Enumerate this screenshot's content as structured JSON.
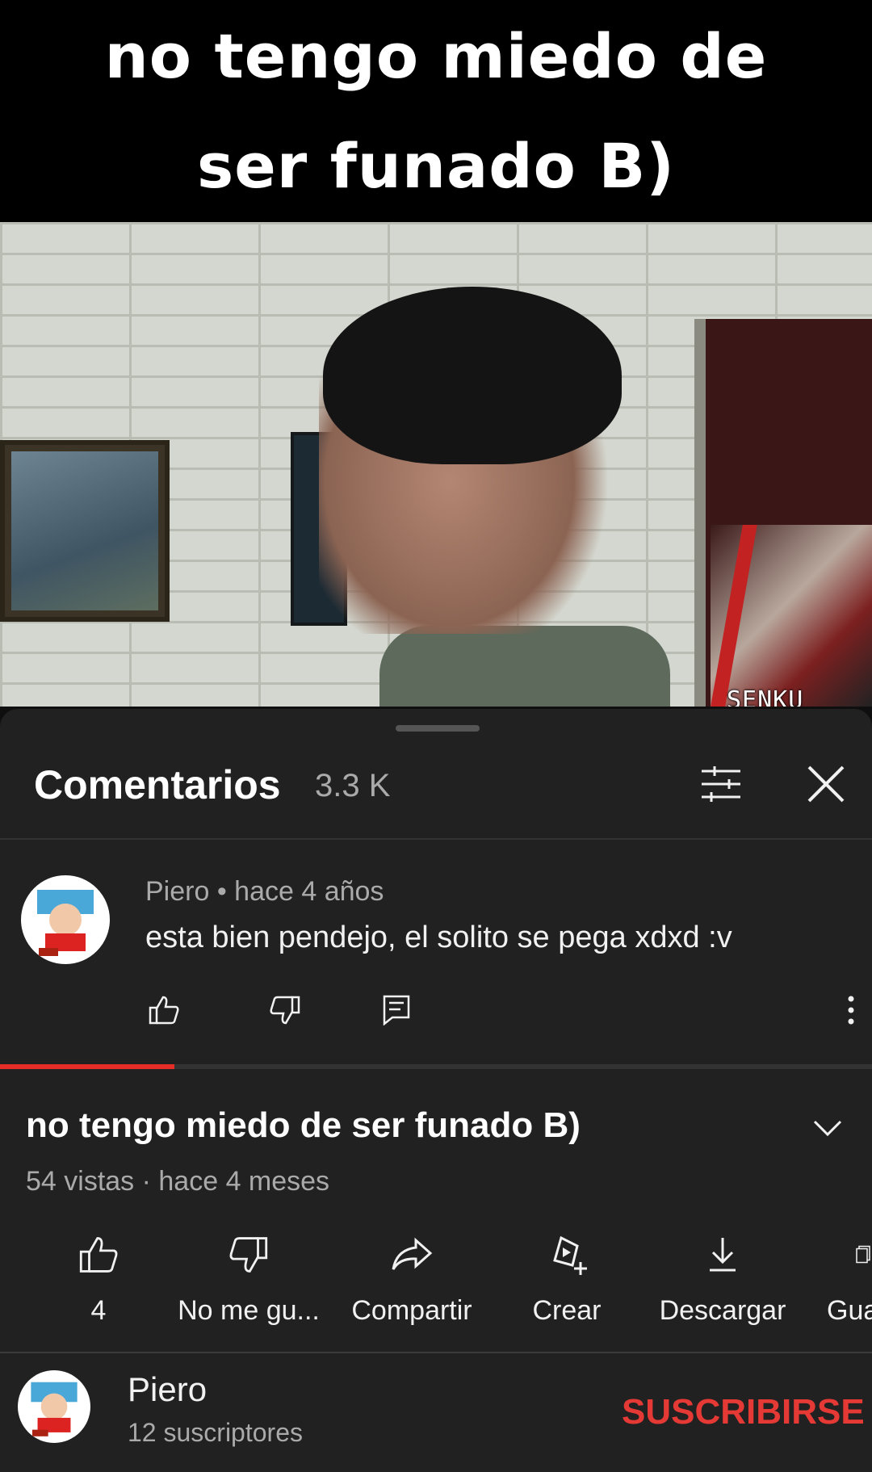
{
  "caption": {
    "text": "no tengo miedo de ser funado B)"
  },
  "video": {
    "watermark": "SENKU SDLG"
  },
  "comments_panel": {
    "title": "Comentarios",
    "count": "3.3 K",
    "comment": {
      "meta": "Piero • hace 4 años",
      "text": "esta bien pendejo, el solito se pega xdxd :v"
    }
  },
  "player": {
    "progress_fraction": 0.2
  },
  "video_info": {
    "title": "no tengo miedo de ser funado B)",
    "meta": "54 vistas · hace 4 meses",
    "actions": [
      {
        "label": "4",
        "icon": "thumbs-up-icon"
      },
      {
        "label": "No me gu...",
        "icon": "thumbs-down-icon"
      },
      {
        "label": "Compartir",
        "icon": "share-icon"
      },
      {
        "label": "Crear",
        "icon": "create-icon"
      },
      {
        "label": "Descargar",
        "icon": "download-icon"
      },
      {
        "label": "Gua",
        "icon": "save-icon"
      }
    ]
  },
  "channel": {
    "name": "Piero",
    "subscribers": "12  suscriptores",
    "subscribe_label": "SUSCRIBIRSE"
  },
  "colors": {
    "accent": "#e53935",
    "sheet_bg": "#212121",
    "muted_text": "#aaaaaa"
  }
}
